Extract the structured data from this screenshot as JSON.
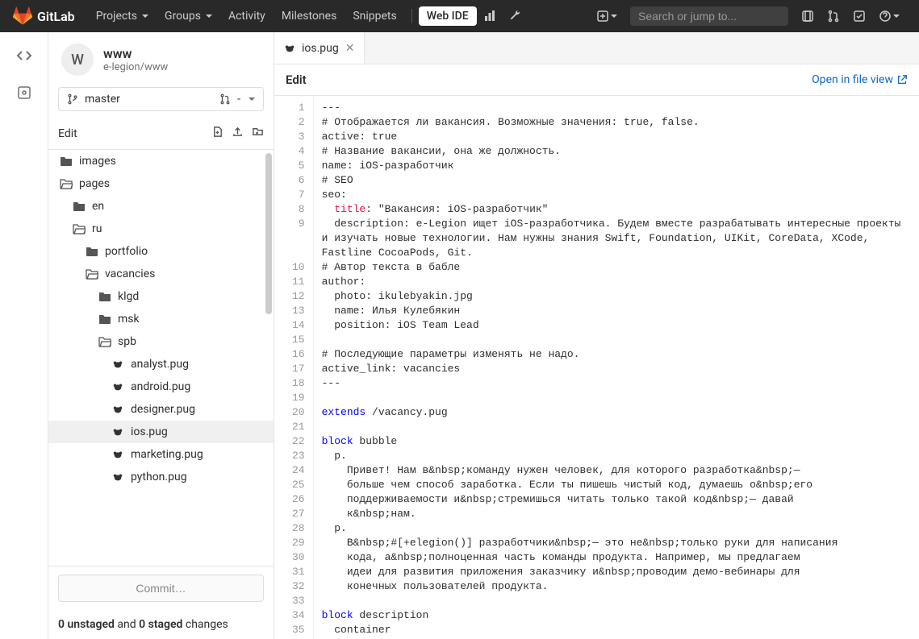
{
  "topbar": {
    "brand": "GitLab",
    "nav": [
      "Projects",
      "Groups",
      "Activity",
      "Milestones",
      "Snippets"
    ],
    "webide": "Web IDE",
    "search_placeholder": "Search or jump to..."
  },
  "project": {
    "avatar_letter": "W",
    "name": "www",
    "path": "e-legion/www"
  },
  "branch": {
    "name": "master",
    "mr": "-"
  },
  "section": {
    "title": "Edit"
  },
  "tree": {
    "items": [
      {
        "icon": "folder",
        "label": "images",
        "indent": 0
      },
      {
        "icon": "folder-open",
        "label": "pages",
        "indent": 0
      },
      {
        "icon": "folder",
        "label": "en",
        "indent": 1
      },
      {
        "icon": "folder-open",
        "label": "ru",
        "indent": 1
      },
      {
        "icon": "folder",
        "label": "portfolio",
        "indent": 2
      },
      {
        "icon": "folder-open",
        "label": "vacancies",
        "indent": 2
      },
      {
        "icon": "folder",
        "label": "klgd",
        "indent": 3
      },
      {
        "icon": "folder",
        "label": "msk",
        "indent": 3
      },
      {
        "icon": "folder-open",
        "label": "spb",
        "indent": 3
      },
      {
        "icon": "pug",
        "label": "analyst.pug",
        "indent": 4
      },
      {
        "icon": "pug",
        "label": "android.pug",
        "indent": 4
      },
      {
        "icon": "pug",
        "label": "designer.pug",
        "indent": 4
      },
      {
        "icon": "pug",
        "label": "ios.pug",
        "indent": 4,
        "active": true
      },
      {
        "icon": "pug",
        "label": "marketing.pug",
        "indent": 4
      },
      {
        "icon": "pug",
        "label": "python.pug",
        "indent": 4
      }
    ]
  },
  "commit": {
    "label": "Commit…"
  },
  "status": {
    "unstaged": "0 unstaged",
    "and": " and ",
    "staged": "0 staged",
    "suffix": " changes"
  },
  "tab": {
    "filename": "ios.pug"
  },
  "toolbar": {
    "title": "Edit",
    "open_link": "Open in file view"
  },
  "code": {
    "lines": [
      "---",
      "# Отображается ли вакансия. Возможные значения: true, false.",
      "active: true",
      "# Название вакансии, она же должность.",
      "name: iOS-разработчик",
      "# SEO",
      "seo:",
      "  title: \"Вакансия: iOS-разработчик\"",
      "  description: e-Legion ищет iOS-разработчика. Будем вместе разрабатывать интересные проекты и изучать новые технологии. Нам нужны знания Swift, Foundation, UIKit, CoreData, XCode, Fastline CocoaPods, Git.",
      "# Автор текста в бабле",
      "author:",
      "  photo: ikulebyakin.jpg",
      "  name: Илья Кулебякин",
      "  position: iOS Team Lead",
      "",
      "# Последующие параметры изменять не надо.",
      "active_link: vacancies",
      "---",
      "",
      "extends /vacancy.pug",
      "",
      "block bubble",
      "  p.",
      "    Привет! Нам в&nbsp;команду нужен человек, для которого разработка&nbsp;—",
      "    больше чем способ заработка. Если ты пишешь чистый код, думаешь о&nbsp;его",
      "    поддерживаемости и&nbsp;стремишься читать только такой код&nbsp;— давай",
      "    к&nbsp;нам.",
      "  p.",
      "    В&nbsp;#[+elegion()] разработчики&nbsp;— это не&nbsp;только руки для написания",
      "    кода, а&nbsp;полноценная часть команды продукта. Например, мы предлагаем",
      "    идеи для развития приложения заказчику и&nbsp;проводим демо-вебинары для",
      "    конечных пользователей продукта.",
      "",
      "block description",
      "  container"
    ]
  }
}
